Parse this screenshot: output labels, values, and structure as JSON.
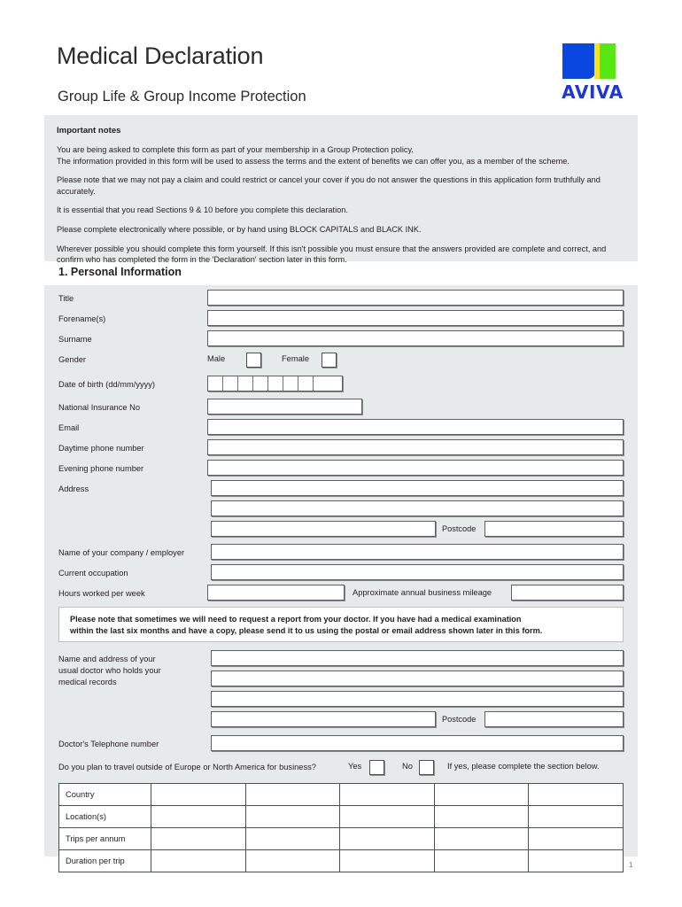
{
  "header": {
    "title": "Medical Declaration",
    "subtitle": "Group Life & Group Income Protection",
    "logo_wordmark": "AVIVA",
    "logo_colors": {
      "blue": "#0a47e0",
      "yellow": "#f5e31c",
      "green": "#56e815",
      "word": "#1c37d8"
    }
  },
  "notes": {
    "heading": "Important notes",
    "paragraphs": [
      "You are being asked to complete this form as part of your membership in a Group Protection policy.",
      "The information provided in this form will be used to assess the terms and the extent of benefits we can offer you, as a member of the scheme.",
      "Please note that we may not pay a claim and could restrict or cancel your cover if you do not answer the questions in this application form truthfully and accurately.",
      "It is essential that you read Sections 9 & 10 before you complete this declaration.",
      "Please complete electronically where possible, or by hand using BLOCK CAPITALS and BLACK INK.",
      "Wherever possible you should complete this form yourself. If this isn't possible you must ensure that the answers provided are complete and correct, and confirm who has completed the form in the 'Declaration' section later in this form."
    ]
  },
  "section": {
    "heading": "1. Personal Information"
  },
  "fields": {
    "title": "Title",
    "forenames": "Forename(s)",
    "surname": "Surname",
    "gender": "Gender",
    "gender_male": "Male",
    "gender_female": "Female",
    "dob": "Date of birth (dd/mm/yyyy)",
    "ni_no": "National Insurance No",
    "email": "Email",
    "daytime_phone": "Daytime phone number",
    "evening_phone": "Evening phone number",
    "address": "Address",
    "postcode": "Postcode",
    "company": "Name of your company / employer",
    "occupation": "Current occupation",
    "hours": "Hours worked per week",
    "mileage": "Approximate annual business mileage",
    "doctor_address": "Name and address of your usual doctor who holds your medical records",
    "doctor_address_lines": [
      "Name and address of your",
      "usual doctor who holds your",
      "medical records"
    ],
    "doctor_postcode": "Postcode",
    "doctor_phone": "Doctor's Telephone number"
  },
  "values": {
    "title": "",
    "forenames": "",
    "surname": "",
    "ni_no": "",
    "email": "",
    "daytime_phone": "",
    "evening_phone": "",
    "address_1": "",
    "address_2": "",
    "address_3": "",
    "postcode": "",
    "company": "",
    "occupation": "",
    "hours": "",
    "mileage": "",
    "doctor_1": "",
    "doctor_2": "",
    "doctor_3": "",
    "doctor_4": "",
    "doctor_postcode": "",
    "doctor_phone": ""
  },
  "doctor_note": {
    "line1": "Please note that sometimes we will need to request a report from your doctor. If you have had a medical examination",
    "line2": "within the last six months and have a copy, please send it to us using the postal or email address shown later in this form."
  },
  "travel": {
    "question": "Do you plan to travel outside of Europe or North America for business?",
    "yes": "Yes",
    "no": "No",
    "hint": "If yes, please complete the section below.",
    "rows": [
      {
        "label": "Country",
        "cells": [
          "",
          "",
          "",
          "",
          ""
        ]
      },
      {
        "label": "Location(s)",
        "cells": [
          "",
          "",
          "",
          "",
          ""
        ]
      },
      {
        "label": "Trips per annum",
        "cells": [
          "",
          "",
          "",
          "",
          ""
        ]
      },
      {
        "label": "Duration per trip",
        "cells": [
          "",
          "",
          "",
          "",
          ""
        ]
      }
    ]
  },
  "footer": {
    "page_number": "1"
  }
}
